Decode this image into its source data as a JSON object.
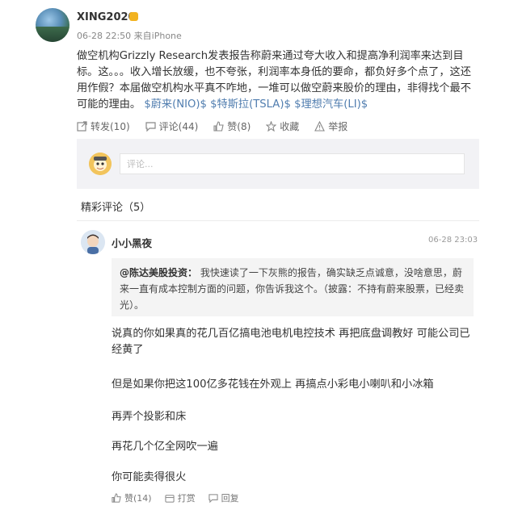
{
  "post": {
    "username": "XING2020",
    "meta": "06-28 22:50 来自iPhone",
    "text": "做空机构Grizzly Research发表报告称蔚来通过夸大收入和提高净利润率来达到目标。这。。。收入增长放缓，也不夸张，利润率本身低的要命，都负好多个点了，这还用作假？本届做空机构水平真不咋地，一堆可以做空蔚来股价的理由，非得找个最不可能的理由。",
    "stock_links": [
      "$蔚来(NIO)$",
      "$特斯拉(TSLA)$",
      "$理想汽车(LI)$"
    ],
    "actions": {
      "repost": "转发(10)",
      "comment": "评论(44)",
      "like": "赞(8)",
      "favorite": "收藏",
      "report": "举报"
    }
  },
  "comment_box": {
    "placeholder": "评论..."
  },
  "comments_section": {
    "title": "精彩评论（5）",
    "comments": [
      {
        "name": "小小黑夜",
        "time": "06-28 23:03",
        "quote_author": "@陈达美股投资：",
        "quote_text": "我快速读了一下灰熊的报告，确实缺乏点诚意，没啥意思，蔚来一直有成本控制方面的问题，你告诉我这个。（披露：不持有蔚来股票，已经卖光）。",
        "replies": [
          "说真的你如果真的花几百亿搞电池电机电控技术 再把底盘调教好 可能公司已经黄了",
          "但是如果你把这100亿多花钱在外观上 再搞点小彩电小喇叭和小冰箱",
          "再弄个投影和床",
          "再花几个亿全网吹一遍",
          "你可能卖得很火"
        ],
        "actions": {
          "like": "赞(14)",
          "tip": "打赏",
          "reply": "回复"
        }
      }
    ]
  }
}
